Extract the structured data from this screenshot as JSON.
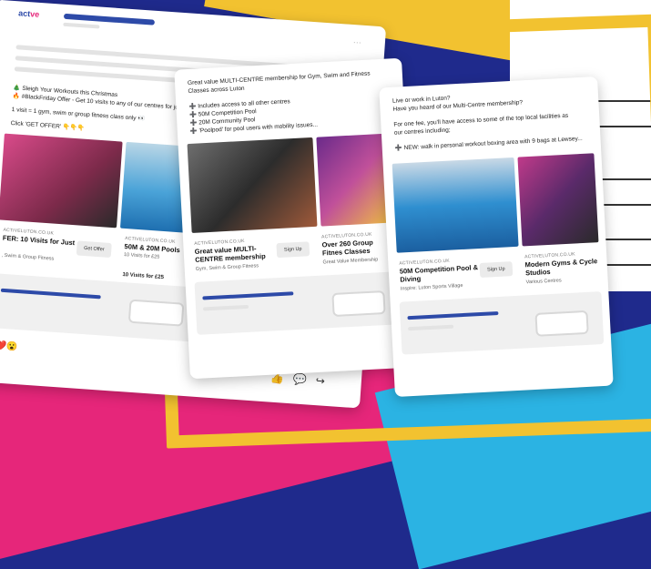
{
  "brand": {
    "logo": "act",
    "logo_suffix": "ve"
  },
  "card1": {
    "lines": [
      "🎄 Sleigh Your Workouts this Christmas",
      "🔥 #BlackFriday Offer - Get 10 visits to any of our centres for just £25!",
      "1 visit = 1 gym, swim or group fitness class only 👀",
      "Click 'GET OFFER' 👇👇👇"
    ],
    "ads": [
      {
        "domain": "ACTIVELUTON.CO.UK",
        "title": "FER: 10 Visits for Just",
        "desc": ", Swim & Group Fitness",
        "button": "Get Offer"
      },
      {
        "domain": "ACTIVELUTON.CO.UK",
        "title": "50M & 20M Pools",
        "desc": "10 Visits for £25",
        "extra": "10 Visits for £25"
      }
    ]
  },
  "card2": {
    "lines": [
      "Great value MULTI-CENTRE membership for Gym, Swim and Fitness",
      "Classes across Luton",
      "",
      "➕ Includes access to all other centres",
      "➕ 50M Competition Pool",
      "➕ 20M Community Pool",
      "➕ 'Poolpod' for pool users with mobility issues..."
    ],
    "ads": [
      {
        "domain": "ACTIVELUTON.CO.UK",
        "title": "Great value MULTI-CENTRE membership",
        "desc": "Gym, Swim & Group Fitness",
        "button": "Sign Up"
      },
      {
        "domain": "ACTIVELUTON.CO.UK",
        "title": "Over 260 Group Fitnes Classes",
        "desc": "Great Value Membership"
      }
    ]
  },
  "card3": {
    "lines": [
      "Live or work in Luton?",
      "Have you heard of our Multi-Centre membership?",
      "",
      "For one fee, you'll have access to some of the top local facilities as",
      "our centres including;",
      "",
      "➕ NEW: walk in personal workout boxing area with 9 bags at Lewsey..."
    ],
    "ads": [
      {
        "domain": "ACTIVELUTON.CO.UK",
        "title": "50M Competition Pool & Diving",
        "desc": "Inspire: Luton Sports Village",
        "button": "Sign Up"
      },
      {
        "domain": "ACTIVELUTON.CO.UK",
        "title": "Modern Gyms & Cycle Studios",
        "desc": "Various Centres"
      }
    ]
  },
  "reactions": "❤️😮",
  "colors": {
    "brand_blue": "#2d4aa8",
    "frame_yellow": "#f2c230",
    "pink": "#e6267a",
    "cyan": "#2bb3e3"
  },
  "icons": [
    "like-icon",
    "comment-icon",
    "share-icon",
    "chevron-right-icon"
  ]
}
